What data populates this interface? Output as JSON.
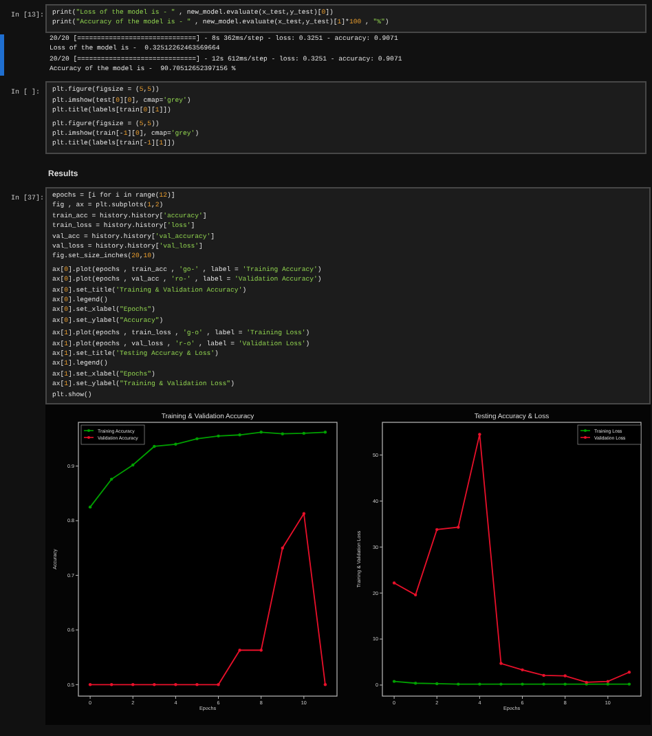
{
  "cells": [
    {
      "kind": "code",
      "prompt": "In [13]:",
      "selected": true,
      "code_blocks": [
        [
          "print(\"Loss of the model is - \" , new_model.evaluate(x_test,y_test)[0])",
          "print(\"Accuracy of the model is - \" , new_model.evaluate(x_test,y_test)[1]*100 , \"%\")"
        ]
      ],
      "output": [
        "20/20 [==============================] - 8s 362ms/step - loss: 0.3251 - accuracy: 0.9071",
        "Loss of the model is -  0.32512262463569664",
        "20/20 [==============================] - 12s 612ms/step - loss: 0.3251 - accuracy: 0.9071",
        "Accuracy of the model is -  90.70512652397156 %"
      ]
    },
    {
      "kind": "code",
      "prompt": "In [ ]:",
      "selected": false,
      "code_blocks": [
        [
          "plt.figure(figsize = (5,5))",
          "plt.imshow(test[0][0], cmap='grey')",
          "plt.title(labels[train[0][1]])"
        ],
        [
          "plt.figure(figsize = (5,5))",
          "plt.imshow(train[-1][0], cmap='grey')",
          "plt.title(labels[train[-1][1]])"
        ]
      ]
    },
    {
      "kind": "markdown",
      "text": "Results"
    },
    {
      "kind": "code",
      "prompt": "In [37]:",
      "selected": false,
      "code_blocks": [
        [
          "epochs = [i for i in range(12)]",
          "fig , ax = plt.subplots(1,2)",
          "train_acc = history.history['accuracy']",
          "train_loss = history.history['loss']",
          "val_acc = history.history['val_accuracy']",
          "val_loss = history.history['val_loss']",
          "fig.set_size_inches(20,10)"
        ],
        [
          "ax[0].plot(epochs , train_acc , 'go-' , label = 'Training Accuracy')",
          "ax[0].plot(epochs , val_acc , 'ro-' , label = 'Validation Accuracy')",
          "ax[0].set_title('Training & Validation Accuracy')",
          "ax[0].legend()",
          "ax[0].set_xlabel(\"Epochs\")",
          "ax[0].set_ylabel(\"Accuracy\")"
        ],
        [
          "ax[1].plot(epochs , train_loss , 'g-o' , label = 'Training Loss')",
          "ax[1].plot(epochs , val_loss , 'r-o' , label = 'Validation Loss')",
          "ax[1].set_title('Testing Accuracy & Loss')",
          "ax[1].legend()",
          "ax[1].set_xlabel(\"Epochs\")",
          "ax[1].set_ylabel(\"Training & Validation Loss\")",
          "plt.show()"
        ]
      ],
      "figure": [
        {
          "chart_data": {
            "type": "line",
            "title": "Training & Validation Accuracy",
            "xlabel": "Epochs",
            "ylabel": "Accuracy",
            "x": [
              0,
              1,
              2,
              3,
              4,
              5,
              6,
              7,
              8,
              9,
              10,
              11
            ],
            "xlim": [
              -0.55,
              11.55
            ],
            "ylim": [
              0.479,
              0.98
            ],
            "xticks": [
              0,
              2,
              4,
              6,
              8,
              10
            ],
            "yticks": [
              0.5,
              0.6,
              0.7,
              0.8,
              0.9
            ],
            "legend": "upper left",
            "series": [
              {
                "name": "Training Accuracy",
                "color": "#00a000",
                "values": [
                  0.825,
                  0.876,
                  0.902,
                  0.936,
                  0.94,
                  0.95,
                  0.955,
                  0.957,
                  0.962,
                  0.959,
                  0.96,
                  0.962
                ]
              },
              {
                "name": "Validation Accuracy",
                "color": "#e8102a",
                "values": [
                  0.5,
                  0.5,
                  0.5,
                  0.5,
                  0.5,
                  0.5,
                  0.5,
                  0.563,
                  0.563,
                  0.75,
                  0.813,
                  0.5
                ]
              }
            ]
          }
        },
        {
          "chart_data": {
            "type": "line",
            "title": "Testing Accuracy & Loss",
            "xlabel": "Epochs",
            "ylabel": "Training & Validation Loss",
            "x": [
              0,
              1,
              2,
              3,
              4,
              5,
              6,
              7,
              8,
              9,
              10,
              11
            ],
            "xlim": [
              -0.55,
              11.55
            ],
            "ylim": [
              -2.4,
              57.1
            ],
            "xticks": [
              0,
              2,
              4,
              6,
              8,
              10
            ],
            "yticks": [
              0,
              10,
              20,
              30,
              40,
              50
            ],
            "legend": "upper right",
            "series": [
              {
                "name": "Training Loss",
                "color": "#00a000",
                "values": [
                  0.8,
                  0.4,
                  0.3,
                  0.2,
                  0.2,
                  0.2,
                  0.2,
                  0.2,
                  0.2,
                  0.2,
                  0.2,
                  0.2
                ]
              },
              {
                "name": "Validation Loss",
                "color": "#e8102a",
                "values": [
                  22.2,
                  19.6,
                  33.8,
                  34.3,
                  54.5,
                  4.7,
                  3.3,
                  2.1,
                  2.0,
                  0.6,
                  0.8,
                  2.8
                ]
              }
            ]
          }
        }
      ]
    }
  ]
}
